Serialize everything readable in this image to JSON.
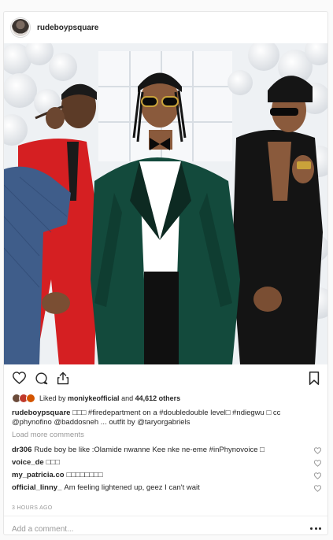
{
  "post": {
    "username": "rudeboypsquare"
  },
  "icons": {
    "like": "heart-icon",
    "comment": "comment-bubble-icon",
    "share": "share-upload-icon",
    "save": "bookmark-icon",
    "more": "more-options-icon"
  },
  "likes": {
    "prefix": "Liked by ",
    "user": "moniykeofficial",
    "and": " and ",
    "count": "44,612 others"
  },
  "caption": {
    "user": "rudeboypsquare",
    "text": " □□□ #firedepartment on a #doubledouble level□ #ndiegwu □ cc @phynofino @baddosneh ... outfit by @taryorgabriels"
  },
  "load_more": "Load more comments",
  "comments": [
    {
      "user": "dr306",
      "text": "Rude boy be like :Olamide nwanne Kee nke ne-eme #inPhynovoice □"
    },
    {
      "user": "voice_de",
      "text": "□□□"
    },
    {
      "user": "my_patricia.co",
      "text": "□□□□□□□□"
    },
    {
      "user": "official_linny_",
      "text": "Am feeling lightened up, geez I can't wait"
    }
  ],
  "timestamp": "3 HOURS AGO",
  "add_comment_placeholder": "Add a comment...",
  "colors": {
    "text": "#262626",
    "muted": "#999999",
    "border": "#e6e6e6",
    "suit_green": "#134a3c"
  }
}
